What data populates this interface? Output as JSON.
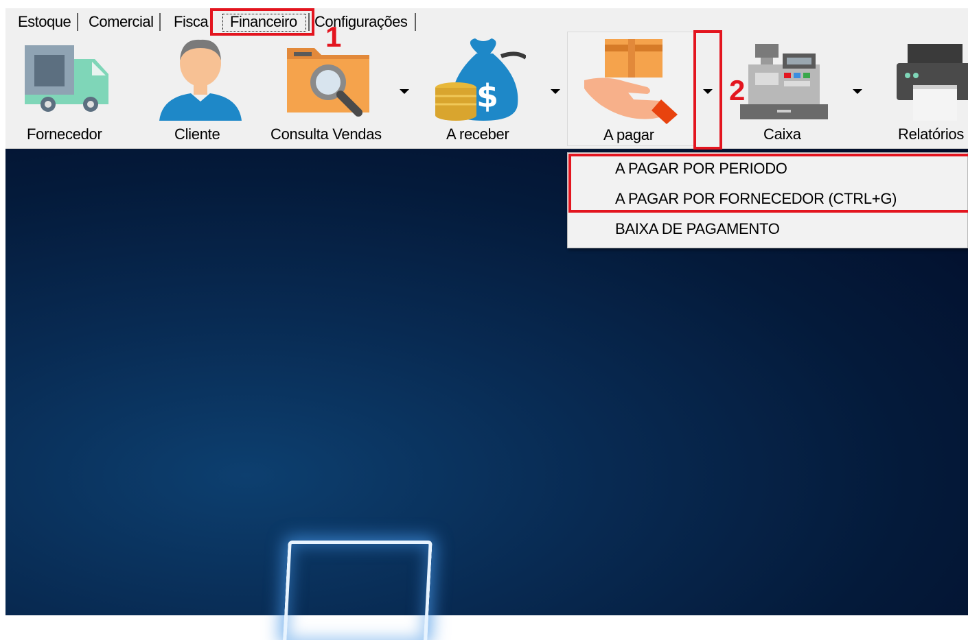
{
  "tabs": [
    {
      "label": "Estoque"
    },
    {
      "label": "Comercial"
    },
    {
      "label": "Fisca"
    },
    {
      "label": "Financeiro"
    },
    {
      "label": "Configurações"
    }
  ],
  "toolbar": {
    "buttons": [
      {
        "label": "Fornecedor",
        "icon": "truck-icon"
      },
      {
        "label": "Cliente",
        "icon": "person-icon"
      },
      {
        "label": "Consulta Vendas",
        "icon": "folder-search-icon"
      },
      {
        "label": "A receber",
        "icon": "money-bag-icon"
      },
      {
        "label": "A pagar",
        "icon": "hand-card-icon"
      },
      {
        "label": "Caixa",
        "icon": "cash-register-icon"
      },
      {
        "label": "Relatórios",
        "icon": "printer-icon"
      }
    ]
  },
  "menu": {
    "items": [
      {
        "label": "A PAGAR POR PERIODO"
      },
      {
        "label": "A PAGAR POR FORNECEDOR (CTRL+G)"
      },
      {
        "label": "BAIXA DE PAGAMENTO"
      }
    ]
  },
  "annotations": {
    "step1": "1",
    "step2": "2",
    "color": "#e3151f"
  },
  "colors": {
    "desktop_dark": "#020c28",
    "desktop_blue": "#0d3f6f",
    "toolbar_bg": "#f0f0f0"
  }
}
